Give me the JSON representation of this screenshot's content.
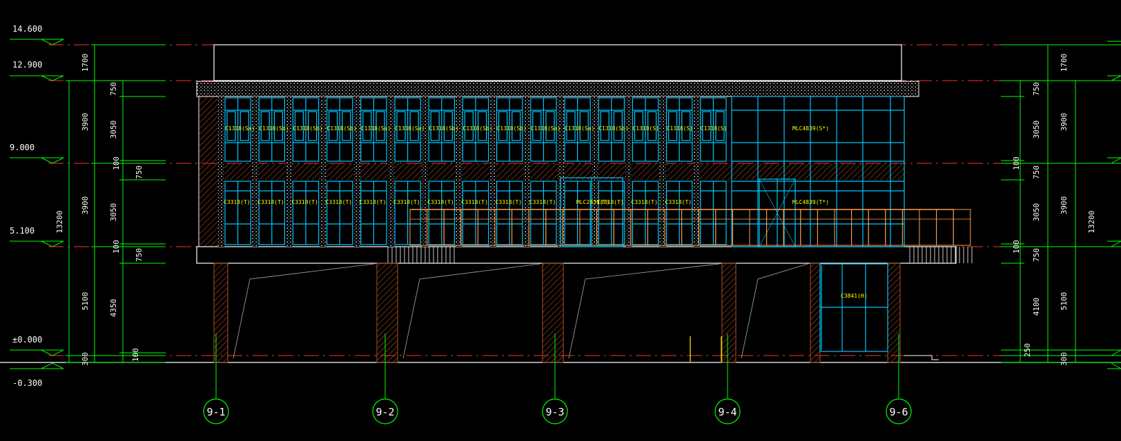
{
  "colors": {
    "background": "#000000",
    "outline": "#ffffff",
    "dimension": "#00ff00",
    "glazing": "#00c8ff",
    "tag": "#ffff00",
    "axis_line": "#ff3030",
    "railing": "#ffa050",
    "hatch": "#b05020"
  },
  "levels_left": [
    "14.600",
    "12.900",
    "9.000",
    "5.100",
    "±0.000",
    "-0.300"
  ],
  "dims_left_outer": [
    "1700",
    "3900",
    "3900",
    "5100",
    "300"
  ],
  "dim_left_total": "13200",
  "dims_left_inner": [
    "750",
    "3050",
    "100",
    "750",
    "3050",
    "100",
    "750",
    "4350",
    "100"
  ],
  "dims_right_outer": [
    "1700",
    "3900",
    "3900",
    "5100",
    "300"
  ],
  "dim_right_total": "13200",
  "dims_right_inner": [
    "750",
    "3050",
    "100",
    "750",
    "3050",
    "100",
    "750",
    "4100",
    "250"
  ],
  "window_tags_upper": [
    "C1318(Sa)",
    "C1318(Sb)",
    "C1318(Sb)",
    "C1318(Sb)",
    "C1318(Sa)",
    "C1318(Sa)",
    "C1318(Sb)",
    "C1318(Sb)",
    "C1318(Sb)",
    "C1318(Sa)",
    "C1318(Sa)",
    "C1318(Sb)",
    "C1318(S)",
    "C1318(S)",
    "C1318(S)",
    "MLC4839(S*)"
  ],
  "window_tags_lower": [
    "C3318(T)",
    "C3318(T)",
    "C3318(T)",
    "C3318(T)",
    "C3318(T)",
    "C3318(T)",
    "C3318(T)",
    "C3318(T)",
    "C3318(T)",
    "C3318(T)",
    "MLC2839(T)",
    "C3318(T)",
    "C3318(T)",
    "C3318(T)",
    "MLC4839(T*)"
  ],
  "window_tag_ground": "C3841(H)",
  "axis_labels": [
    "9-1",
    "9-2",
    "9-3",
    "9-4",
    "9-6"
  ]
}
